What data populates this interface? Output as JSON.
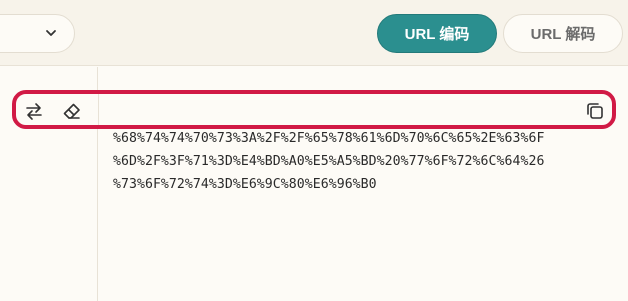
{
  "toolbar": {
    "encode_label": "URL 编码",
    "decode_label": "URL 解码"
  },
  "icons": {
    "dropdown": "chevron-down-icon",
    "swap": "swap-arrows-icon",
    "clear": "eraser-icon",
    "copy": "copy-icon"
  },
  "output": {
    "lines": [
      "%68%74%74%70%73%3A%2F%2F%65%78%61%6D%70%6C%65%2E%63%6F",
      "%6D%2F%3F%71%3D%E4%BD%A0%E5%A5%BD%20%77%6F%72%6C%64%26",
      "%73%6F%72%74%3D%E6%9C%80%E6%96%B0"
    ]
  },
  "colors": {
    "accent": "#2b8f8f",
    "highlight": "#d11a45",
    "background": "#fdfbf6"
  }
}
